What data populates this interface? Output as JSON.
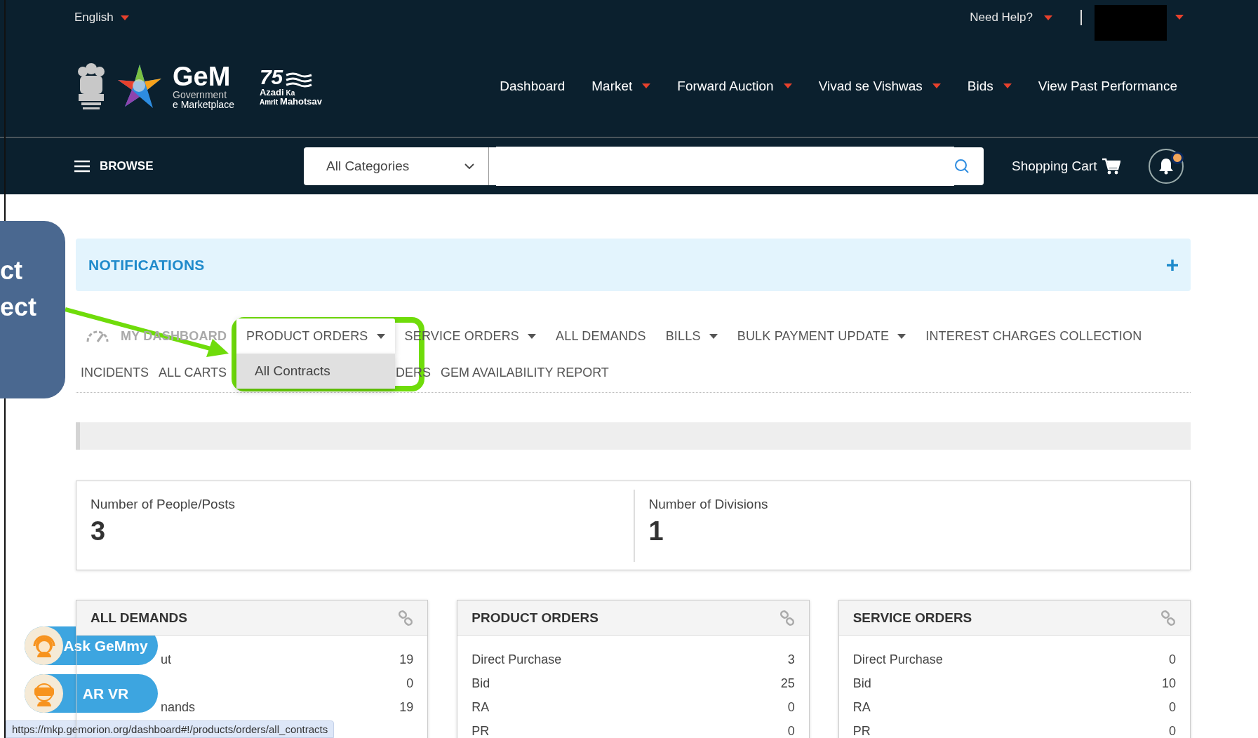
{
  "header": {
    "language": "English",
    "help": "Need Help?",
    "account_redacted": true,
    "logo": {
      "name": "GeM",
      "line1": "Government",
      "line2": "e Marketplace"
    },
    "azadi": {
      "number": "75",
      "word1": "Azadi",
      "word2": "Ka",
      "word3": "Amrit",
      "word4": "Mahotsav"
    },
    "nav": [
      {
        "label": "Dashboard",
        "dropdown": false
      },
      {
        "label": "Market",
        "dropdown": true
      },
      {
        "label": "Forward Auction",
        "dropdown": true
      },
      {
        "label": "Vivad se Vishwas",
        "dropdown": true
      },
      {
        "label": "Bids",
        "dropdown": true
      },
      {
        "label": "View Past Performance",
        "dropdown": false
      }
    ],
    "browse": "BROWSE",
    "category": "All Categories",
    "cart": "Shopping Cart",
    "unread": true
  },
  "notifications": {
    "title": "NOTIFICATIONS"
  },
  "tab_rows": [
    [
      {
        "label": "MY DASHBOARD",
        "selected": true,
        "dropdown": false,
        "expanded": false
      },
      {
        "label": "PRODUCT ORDERS",
        "selected": false,
        "dropdown": true,
        "expanded": true
      },
      {
        "label": "SERVICE ORDERS",
        "selected": false,
        "dropdown": true,
        "expanded": false
      },
      {
        "label": "ALL DEMANDS",
        "selected": false,
        "dropdown": false,
        "expanded": false
      },
      {
        "label": "BILLS",
        "selected": false,
        "dropdown": true,
        "expanded": false
      },
      {
        "label": "BULK PAYMENT UPDATE",
        "selected": false,
        "dropdown": true,
        "expanded": false
      },
      {
        "label": "INTEREST CHARGES COLLECTION",
        "selected": false,
        "dropdown": false,
        "expanded": false
      }
    ],
    [
      {
        "label": "INCIDENTS",
        "selected": false,
        "dropdown": false,
        "expanded": false
      },
      {
        "label": "ALL CARTS",
        "selected": false,
        "dropdown": false,
        "expanded": false
      },
      {
        "label": "DERS",
        "selected": false,
        "dropdown": false,
        "expanded": false
      },
      {
        "label": "GEM AVAILABILITY REPORT",
        "selected": false,
        "dropdown": false,
        "expanded": false
      }
    ]
  ],
  "dropdown_menu": {
    "items": [
      {
        "label": "All Contracts",
        "selected": true
      }
    ]
  },
  "stats": [
    {
      "label": "Number of People/Posts",
      "value": "3"
    },
    {
      "label": "Number of Divisions",
      "value": "1"
    }
  ],
  "cards": [
    {
      "title": "ALL DEMANDS",
      "rows": [
        {
          "label": "ut",
          "value": "19"
        },
        {
          "value": "0"
        },
        {
          "label": "nands",
          "value": "19"
        }
      ]
    },
    {
      "title": "PRODUCT ORDERS",
      "rows": [
        {
          "label": "Direct Purchase",
          "value": "3"
        },
        {
          "label": "Bid",
          "value": "25"
        },
        {
          "label": "RA",
          "value": "0"
        },
        {
          "label": "PR",
          "value": "0"
        }
      ]
    },
    {
      "title": "SERVICE ORDERS",
      "rows": [
        {
          "label": "Direct Purchase",
          "value": "0"
        },
        {
          "label": "Bid",
          "value": "10"
        },
        {
          "label": "RA",
          "value": "0"
        },
        {
          "label": "PR",
          "value": "0"
        }
      ]
    }
  ],
  "floating_buttons": [
    {
      "label": "Ask GeMmy",
      "kind": "support"
    },
    {
      "label": "AR VR",
      "kind": "vr"
    }
  ],
  "status_url": "https://mkp.gemorion.org/dashboard#!/products/orders/all_contracts",
  "callout": {
    "lines": [
      "ct",
      "ect"
    ]
  }
}
